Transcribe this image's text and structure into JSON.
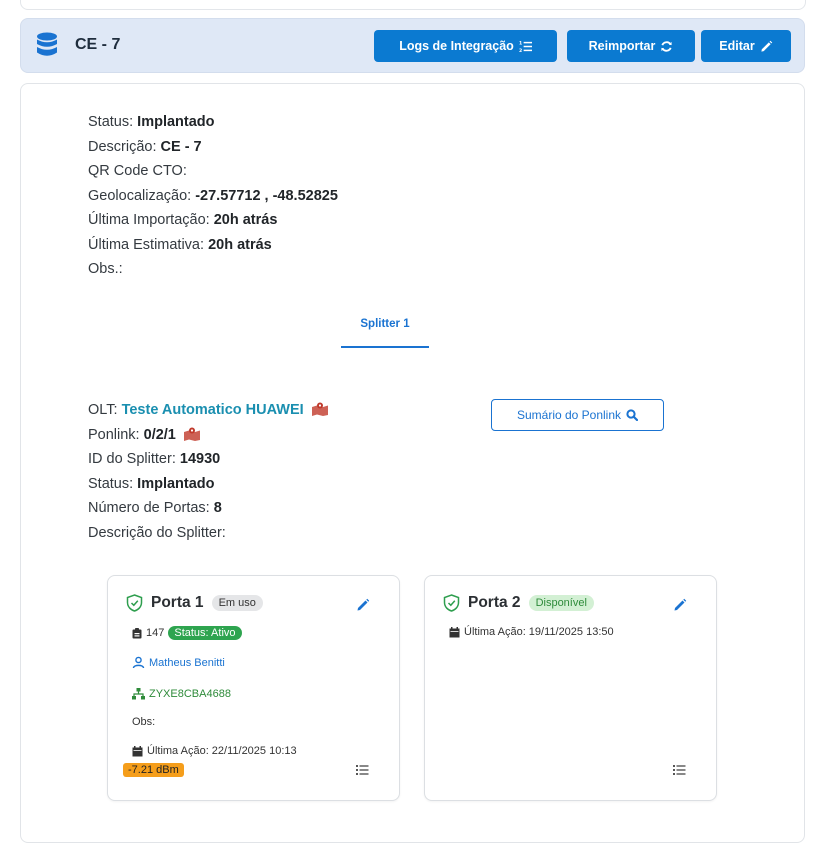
{
  "header": {
    "title": "CE - 7",
    "buttons": {
      "logs": "Logs de Integração",
      "reimportar": "Reimportar",
      "editar": "Editar"
    }
  },
  "cto_info": [
    {
      "label": "Status:",
      "value": "Implantado"
    },
    {
      "label": "Descrição:",
      "value": "CE - 7"
    },
    {
      "label": "QR Code CTO:",
      "value": ""
    },
    {
      "label": "Geolocalização:",
      "value": "-27.57712 , -48.52825"
    },
    {
      "label": "Última Importação:",
      "value": "20h atrás"
    },
    {
      "label": "Última Estimativa:",
      "value": "20h atrás"
    },
    {
      "label": "Obs.:",
      "value": ""
    }
  ],
  "tabs": [
    "Splitter 1"
  ],
  "splitter": {
    "olt_label": "OLT:",
    "olt_value": "Teste Automatico HUAWEI",
    "ponlink_label": "Ponlink:",
    "ponlink_value": "0/2/1",
    "id_label": "ID do Splitter:",
    "id_value": "14930",
    "status_label": "Status:",
    "status_value": "Implantado",
    "portas_label": "Número de Portas:",
    "portas_value": "8",
    "descricao_label": "Descrição do Splitter:",
    "sumario_button": "Sumário do Ponlink"
  },
  "portas": [
    {
      "title": "Porta 1",
      "badge": "Em uso",
      "client_id": "147",
      "status": "Status: Ativo",
      "user": "Matheus Benitti",
      "onu": "ZYXE8CBA4688",
      "obs": "Obs:",
      "ultima_acao": "Última Ação: 22/11/2025 10:13",
      "signal": "-7.21 dBm"
    },
    {
      "title": "Porta 2",
      "badge": "Disponível",
      "ultima_acao": "Última Ação: 19/11/2025 13:50"
    }
  ],
  "colors": {
    "primary": "#0b7ad1",
    "header_bg": "#dfe8f6",
    "success": "#2ea44f",
    "warning": "#f59e1b",
    "map_icon": "#c0392b"
  }
}
